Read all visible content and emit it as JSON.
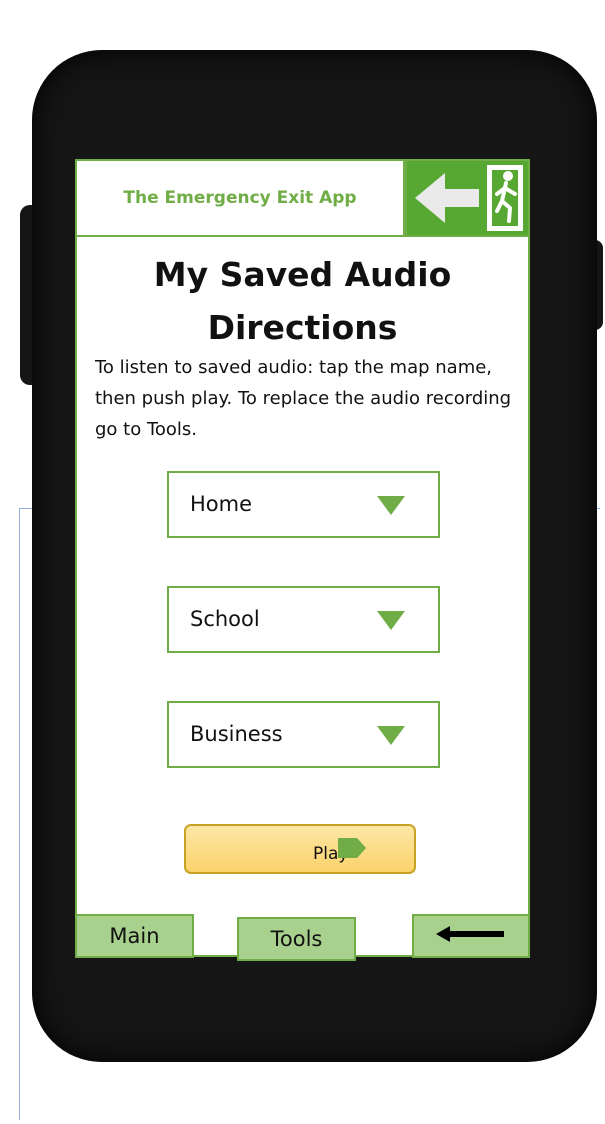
{
  "app": {
    "title": "The Emergency Exit App"
  },
  "page": {
    "title": "My Saved Audio Directions",
    "instructions": "To listen to saved audio: tap the map name, then push play. To replace the audio recording go to Tools."
  },
  "dropdowns": [
    {
      "label": "Home"
    },
    {
      "label": "School"
    },
    {
      "label": "Business"
    }
  ],
  "play_button": {
    "label": "Play"
  },
  "nav": {
    "main_label": "Main",
    "tools_label": "Tools"
  },
  "icons": {
    "exit_sign": "emergency-exit-sign-icon",
    "dropdown_arrow": "triangle-down-icon",
    "play": "play-arrow-icon",
    "back": "arrow-left-icon"
  },
  "colors": {
    "accent_green": "#70ad47",
    "nav_button_fill": "#a9d18e",
    "exit_sign_green": "#56a832",
    "play_button_fill": "#fbd26b"
  }
}
